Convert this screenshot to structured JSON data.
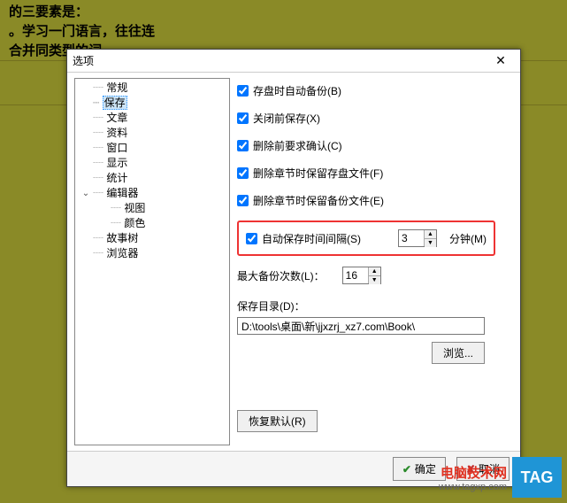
{
  "bg": {
    "line1": "的三要素是：",
    "line2": "。学习一门语言，往往连",
    "line3": "合并同类型的词"
  },
  "dialog": {
    "title": "选项",
    "close": "✕"
  },
  "tree": {
    "items": [
      "常规",
      "保存",
      "文章",
      "资料",
      "窗口",
      "显示",
      "统计",
      "编辑器"
    ],
    "editor_children": [
      "视图",
      "颜色"
    ],
    "after": [
      "故事树",
      "浏览器"
    ]
  },
  "panel": {
    "chk1": "存盘时自动备份(B)",
    "chk2": "关闭前保存(X)",
    "chk3": "删除前要求确认(C)",
    "chk4": "删除章节时保留存盘文件(F)",
    "chk5": "删除章节时保留备份文件(E)",
    "chk6": "自动保存时间间隔(S)",
    "interval_value": "3",
    "interval_unit": "分钟(M)",
    "max_label": "最大备份次数(L)：",
    "max_value": "16",
    "dir_label": "保存目录(D)：",
    "dir_value": "D:\\tools\\桌面\\新\\jjxzrj_xz7.com\\Book\\",
    "browse": "浏览...",
    "restore": "恢复默认(R)"
  },
  "footer": {
    "ok": "确定",
    "cancel": "取消"
  },
  "watermark": {
    "brand": "电脑技术网",
    "url": "www.tagxp.com",
    "tag": "TAG"
  }
}
